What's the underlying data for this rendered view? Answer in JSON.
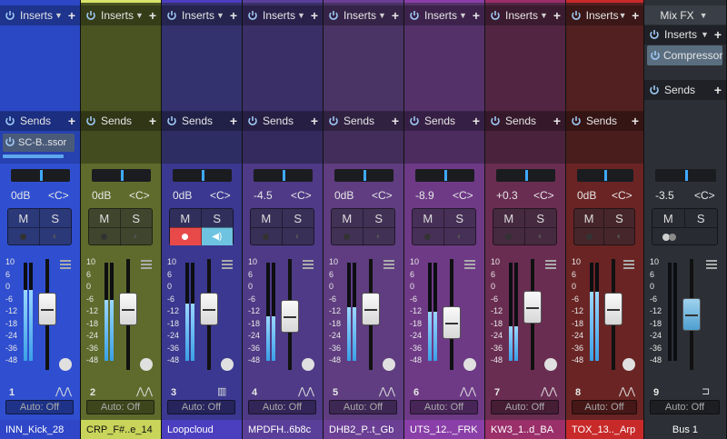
{
  "labels": {
    "inserts": "Inserts",
    "sends": "Sends",
    "mix_fx": "Mix FX",
    "mute": "M",
    "solo": "S"
  },
  "channels": [
    {
      "number": "1",
      "name": "INN_Kick_28",
      "volume": "0dB",
      "pan": "<C>",
      "automation": "Auto: Off",
      "color": "#2f4fd0",
      "name_bg": "#2f46c8",
      "top_bg": "#2a48c4",
      "send_slot": "SC-B..ssor"
    },
    {
      "number": "2",
      "name": "CRP_F#..e_14",
      "volume": "0dB",
      "pan": "<C>",
      "automation": "Auto: Off",
      "color": "#5e6b2c",
      "name_bg": "#c8d45a",
      "top_bg": "#4a5422",
      "accent": "#d8e46a"
    },
    {
      "number": "3",
      "name": "Loopcloud",
      "volume": "0dB",
      "pan": "<C>",
      "automation": "Auto: Off",
      "color": "#3a3890",
      "name_bg": "#4b3fc0",
      "top_bg": "#33326e",
      "armed": true
    },
    {
      "number": "4",
      "name": "MPDFH..6b8c",
      "volume": "-4.5",
      "pan": "<C>",
      "automation": "Auto: Off",
      "color": "#4e3a86",
      "name_bg": "#5a3f9a",
      "top_bg": "#3b2f68"
    },
    {
      "number": "5",
      "name": "DHB2_P..t_Gb",
      "volume": "0dB",
      "pan": "<C>",
      "automation": "Auto: Off",
      "color": "#5f3d80",
      "name_bg": "#6a3f94",
      "top_bg": "#4a3365"
    },
    {
      "number": "6",
      "name": "UTS_12.._FRK",
      "volume": "-8.9",
      "pan": "<C>",
      "automation": "Auto: Off",
      "color": "#6e3a86",
      "name_bg": "#8a3fa8",
      "top_bg": "#55316a"
    },
    {
      "number": "7",
      "name": "KW3_1..d_BA",
      "volume": "+0.3",
      "pan": "<C>",
      "automation": "Auto: Off",
      "color": "#6a2d52",
      "name_bg": "#9a2f6a",
      "top_bg": "#522642"
    },
    {
      "number": "8",
      "name": "TOX_13.._Arp",
      "volume": "0dB",
      "pan": "<C>",
      "automation": "Auto: Off",
      "color": "#6a2424",
      "name_bg": "#c82a2a",
      "top_bg": "#522020"
    }
  ],
  "bus": {
    "number": "9",
    "name": "Bus 1",
    "volume": "-3.5",
    "pan": "<C>",
    "automation": "Auto: Off",
    "insert_plugin": "Compressor"
  },
  "scale": [
    "10",
    "6",
    "0",
    "-6",
    "-12",
    "-18",
    "-24",
    "-36",
    "-48"
  ],
  "colors": {
    "meter": "#3aa0e6",
    "rec_active": "#e84a4a",
    "monitor_active": "#6ec4e0",
    "bus_bg": "#2c2f35"
  }
}
